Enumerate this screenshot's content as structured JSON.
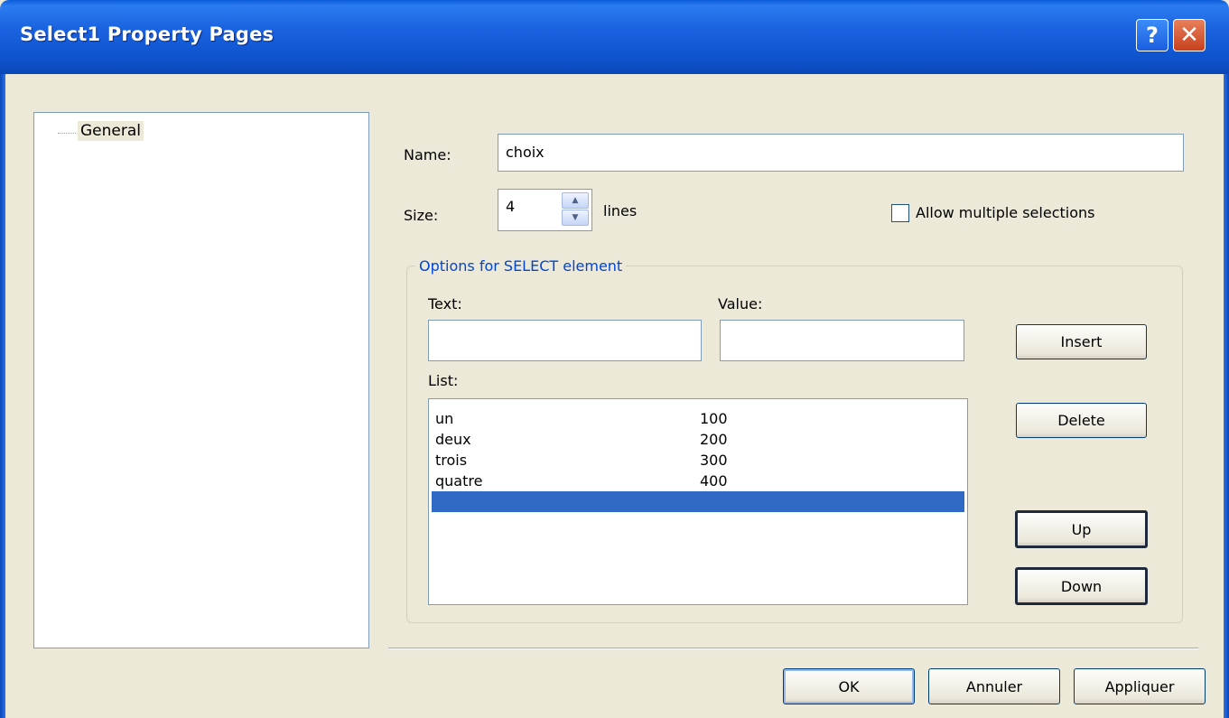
{
  "window": {
    "title": "Select1 Property Pages"
  },
  "titlebar": {
    "help_label": "?",
    "close_label": "✕"
  },
  "tree": {
    "items": [
      {
        "label": "General"
      }
    ]
  },
  "form": {
    "name_label": "Name:",
    "name_value": "choix",
    "size_label": "Size:",
    "size_value": "4",
    "size_units": "lines",
    "allow_multiple_label": "Allow multiple selections",
    "allow_multiple_checked": false
  },
  "options_group": {
    "title": "Options for SELECT element",
    "text_label": "Text:",
    "text_value": "",
    "value_label": "Value:",
    "value_value": "",
    "list_label": "List:",
    "list": [
      {
        "text": "un",
        "value": "100"
      },
      {
        "text": "deux",
        "value": "200"
      },
      {
        "text": "trois",
        "value": "300"
      },
      {
        "text": "quatre",
        "value": "400"
      },
      {
        "text": "",
        "value": "",
        "selected": true
      }
    ],
    "buttons": {
      "insert": "Insert",
      "delete": "Delete",
      "up": "Up",
      "down": "Down"
    }
  },
  "footer": {
    "ok": "OK",
    "cancel": "Annuler",
    "apply": "Appliquer"
  },
  "colors": {
    "titlebar": "#0a5bd8",
    "selection": "#316ac5",
    "group_title": "#0046d5"
  }
}
